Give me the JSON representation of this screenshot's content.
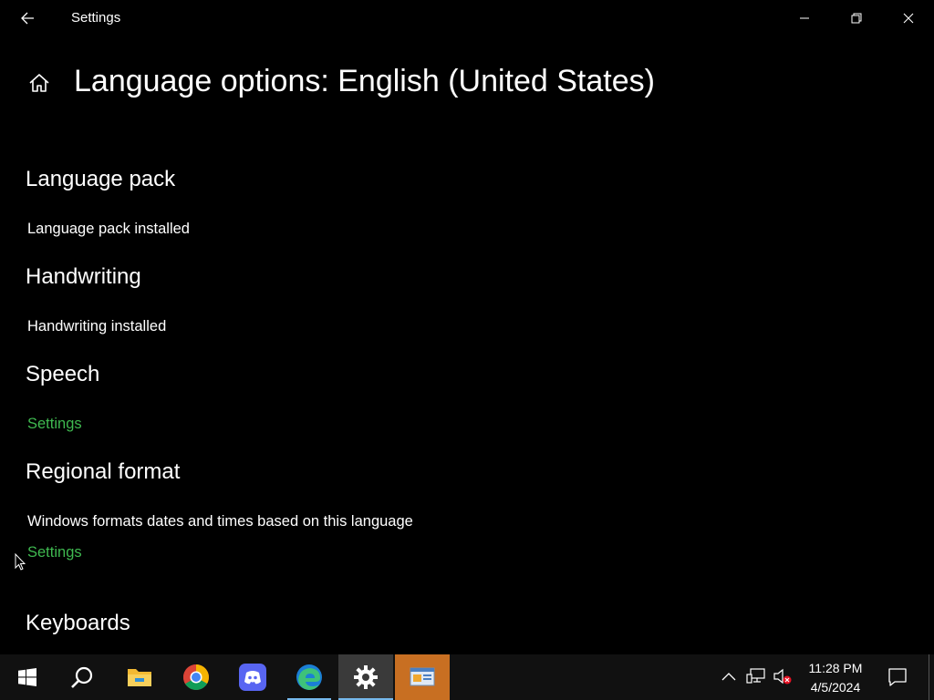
{
  "window": {
    "title": "Settings",
    "back_icon": "back-arrow-icon",
    "minimize_icon": "minimize-icon",
    "maximize_icon": "restore-icon",
    "close_icon": "close-icon"
  },
  "page": {
    "home_icon": "home-icon",
    "title": "Language options: English (United States)"
  },
  "sections": {
    "language_pack": {
      "title": "Language pack",
      "status": "Language pack installed"
    },
    "handwriting": {
      "title": "Handwriting",
      "status": "Handwriting installed"
    },
    "speech": {
      "title": "Speech",
      "link": "Settings"
    },
    "regional_format": {
      "title": "Regional format",
      "description": "Windows formats dates and times based on this language",
      "link": "Settings"
    },
    "keyboards": {
      "title": "Keyboards"
    }
  },
  "colors": {
    "background": "#000000",
    "link": "#3fb950",
    "taskbar": "#111111",
    "active_app": "#3a3a3a",
    "highlight_app": "#c86f22"
  },
  "taskbar": {
    "apps": [
      {
        "name": "start",
        "icon": "windows-logo-icon"
      },
      {
        "name": "search",
        "icon": "search-icon"
      },
      {
        "name": "file-explorer",
        "icon": "folder-icon"
      },
      {
        "name": "chrome",
        "icon": "chrome-icon"
      },
      {
        "name": "discord",
        "icon": "discord-icon"
      },
      {
        "name": "edge",
        "icon": "edge-icon"
      },
      {
        "name": "settings",
        "icon": "gear-icon"
      },
      {
        "name": "control-panel",
        "icon": "control-panel-icon"
      }
    ],
    "tray": {
      "chevron_icon": "chevron-up-icon",
      "network_icon": "network-icon",
      "volume_icon": "volume-muted-icon"
    },
    "clock": {
      "time": "11:28 PM",
      "date": "4/5/2024"
    },
    "notification_icon": "notification-icon"
  }
}
